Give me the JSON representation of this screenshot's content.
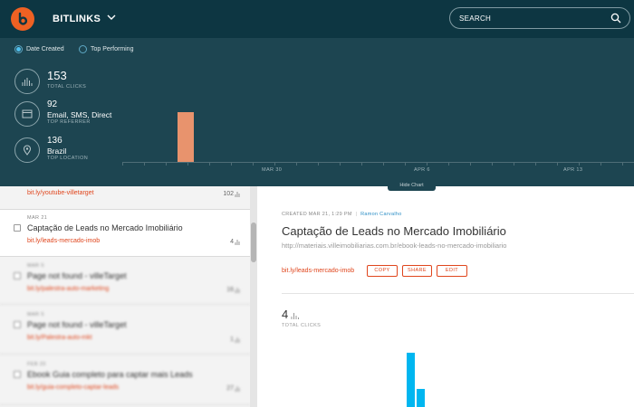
{
  "header": {
    "brand": "BITLINKS",
    "search_placeholder": "SEARCH"
  },
  "filters": {
    "date_created": "Date Created",
    "top_performing": "Top Performing",
    "selected": "Date Created"
  },
  "stats": {
    "clicks": {
      "value": "153",
      "caption": "TOTAL CLICKS"
    },
    "referrer": {
      "value": "92",
      "name": "Email, SMS, Direct",
      "caption": "TOP REFERRER"
    },
    "location": {
      "value": "136",
      "name": "Brazil",
      "caption": "TOP LOCATION"
    }
  },
  "chart_data": {
    "type": "bar",
    "x_labels": [
      "MAR 30",
      "APR 6",
      "APR 13"
    ],
    "bars": [
      {
        "x": "MAR 21",
        "value": 92
      }
    ],
    "ylim": [
      0,
      100
    ]
  },
  "hide_chart": "Hide Chart",
  "list": [
    {
      "date": "",
      "title": "",
      "link": "bit.ly/youtube-villetarget",
      "count": "102"
    },
    {
      "date": "MAR 21",
      "title": "Captação de Leads no Mercado Imobiliário",
      "link": "bit.ly/leads-mercado-imob",
      "count": "4"
    },
    {
      "date": "MAR 5",
      "title": "Page not found - villeTarget",
      "link": "bit.ly/palestra-auto-marketing",
      "count": "16"
    },
    {
      "date": "MAR 5",
      "title": "Page not found - villeTarget",
      "link": "bit.ly/Palestra-auto-mkt",
      "count": "1"
    },
    {
      "date": "FEB 20",
      "title": "Ebook Guia completo para captar mais Leads",
      "link": "bit.ly/guia-completo-captar-leads",
      "count": "27"
    }
  ],
  "detail": {
    "created": "CREATED MAR 21, 1:29 PM",
    "separator": "|",
    "author": "Ramon Carvalho",
    "title": "Captação de Leads no Mercado Imobiliário",
    "url": "http://materiais.villeimobiliarias.com.br/ebook-leads-no-mercado-imobiliario",
    "short_link": "bit.ly/leads-mercado-imob",
    "copy": "COPY",
    "share": "SHARE",
    "edit": "EDIT",
    "clicks": "4",
    "clicks_caption": "TOTAL CLICKS",
    "chart_bars": [
      3,
      1
    ]
  },
  "colors": {
    "topbar": "#0d3642",
    "stats_bg": "#1d4551",
    "accent": "#ee6123",
    "link": "#e0461d",
    "bar_orange": "#e8936d",
    "bar_blue": "#00b6f0"
  }
}
